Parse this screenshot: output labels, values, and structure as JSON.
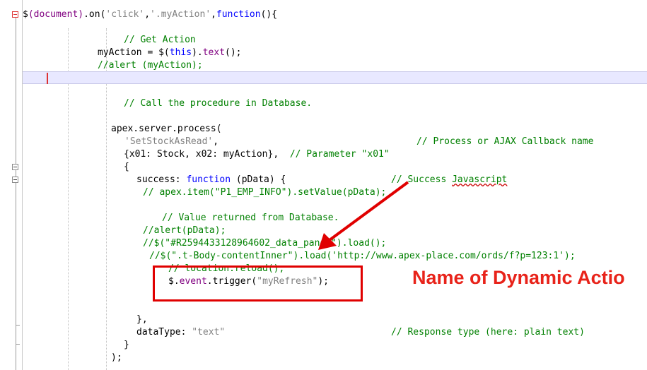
{
  "editor": {
    "lines": [
      {
        "parts": [
          {
            "t": "$",
            "c": "plain"
          },
          {
            "t": "(document)",
            "c": "purp"
          },
          {
            "t": ".on(",
            "c": "plain"
          },
          {
            "t": "'click'",
            "c": "str"
          },
          {
            "t": ",",
            "c": "plain"
          },
          {
            "t": "'.myAction'",
            "c": "str"
          },
          {
            "t": ",",
            "c": "plain"
          },
          {
            "t": "function",
            "c": "kw"
          },
          {
            "t": "(){",
            "c": "plain"
          }
        ]
      },
      {
        "parts": [
          {
            "t": "// Get Action",
            "c": "cmt"
          }
        ]
      },
      {
        "parts": [
          {
            "t": "myAction = $(",
            "c": "plain"
          },
          {
            "t": "this",
            "c": "kw"
          },
          {
            "t": ").",
            "c": "plain"
          },
          {
            "t": "text",
            "c": "purp"
          },
          {
            "t": "();",
            "c": "plain"
          }
        ]
      },
      {
        "parts": [
          {
            "t": "//alert (myAction);",
            "c": "cmt"
          }
        ]
      },
      {
        "parts": [
          {
            "t": "// Call the procedure in Database.",
            "c": "cmt"
          }
        ]
      },
      {
        "parts": [
          {
            "t": "apex.server.process(",
            "c": "plain"
          }
        ]
      },
      {
        "parts": [
          {
            "t": "'SetStockAsRead'",
            "c": "str"
          },
          {
            "t": ",",
            "c": "plain"
          }
        ]
      },
      {
        "parts": [
          {
            "t": "// Process or AJAX Callback name",
            "c": "cmt"
          }
        ]
      },
      {
        "parts": [
          {
            "t": "{x01: Stock, x02: myAction},  ",
            "c": "plain"
          },
          {
            "t": "// Parameter \"x01\"",
            "c": "cmt"
          }
        ]
      },
      {
        "parts": [
          {
            "t": "{",
            "c": "plain"
          }
        ]
      },
      {
        "parts": [
          {
            "t": "success: ",
            "c": "plain"
          },
          {
            "t": "function",
            "c": "kw"
          },
          {
            "t": " (pData) {",
            "c": "plain"
          }
        ]
      },
      {
        "parts": [
          {
            "t": "// Success ",
            "c": "cmt"
          },
          {
            "t": "Javascript",
            "c": "cmt wavy"
          }
        ]
      },
      {
        "parts": [
          {
            "t": "// apex.item(\"P1_EMP_INFO\").setValue(pData);",
            "c": "cmt"
          }
        ]
      },
      {
        "parts": [
          {
            "t": "// Value returned from Database.",
            "c": "cmt"
          }
        ]
      },
      {
        "parts": [
          {
            "t": "//alert(pData);",
            "c": "cmt"
          }
        ]
      },
      {
        "parts": [
          {
            "t": "//$(\"#R2594433128964602_data_panel\").load();",
            "c": "cmt"
          }
        ]
      },
      {
        "parts": [
          {
            "t": "//$(\".t-Body-contentInner\").load('",
            "c": "cmt"
          },
          {
            "t": "http://www.apex-place.com/ords/f?p=123:1",
            "c": "cmt"
          },
          {
            "t": "');",
            "c": "cmt"
          }
        ]
      },
      {
        "parts": [
          {
            "t": "// location.reload();",
            "c": "cmt"
          }
        ]
      },
      {
        "parts": [
          {
            "t": "$.",
            "c": "plain"
          },
          {
            "t": "event",
            "c": "purp"
          },
          {
            "t": ".trigger(",
            "c": "plain"
          },
          {
            "t": "\"myRefresh\"",
            "c": "str"
          },
          {
            "t": ");",
            "c": "plain"
          }
        ]
      },
      {
        "parts": [
          {
            "t": "},",
            "c": "plain"
          }
        ]
      },
      {
        "parts": [
          {
            "t": "dataType: ",
            "c": "plain"
          },
          {
            "t": "\"text\"",
            "c": "str"
          }
        ]
      },
      {
        "parts": [
          {
            "t": "// Response type (here: plain text)",
            "c": "cmt"
          }
        ]
      },
      {
        "parts": [
          {
            "t": "}",
            "c": "plain"
          }
        ]
      },
      {
        "parts": [
          {
            "t": ");",
            "c": "plain"
          }
        ]
      }
    ]
  },
  "annotation": {
    "label": "Name of Dynamic Actio",
    "color": "#e8231a"
  },
  "colors": {
    "keyword": "#0000ff",
    "string": "#808080",
    "comment": "#008000",
    "member": "#800080",
    "current_line": "#e8e8ff"
  }
}
